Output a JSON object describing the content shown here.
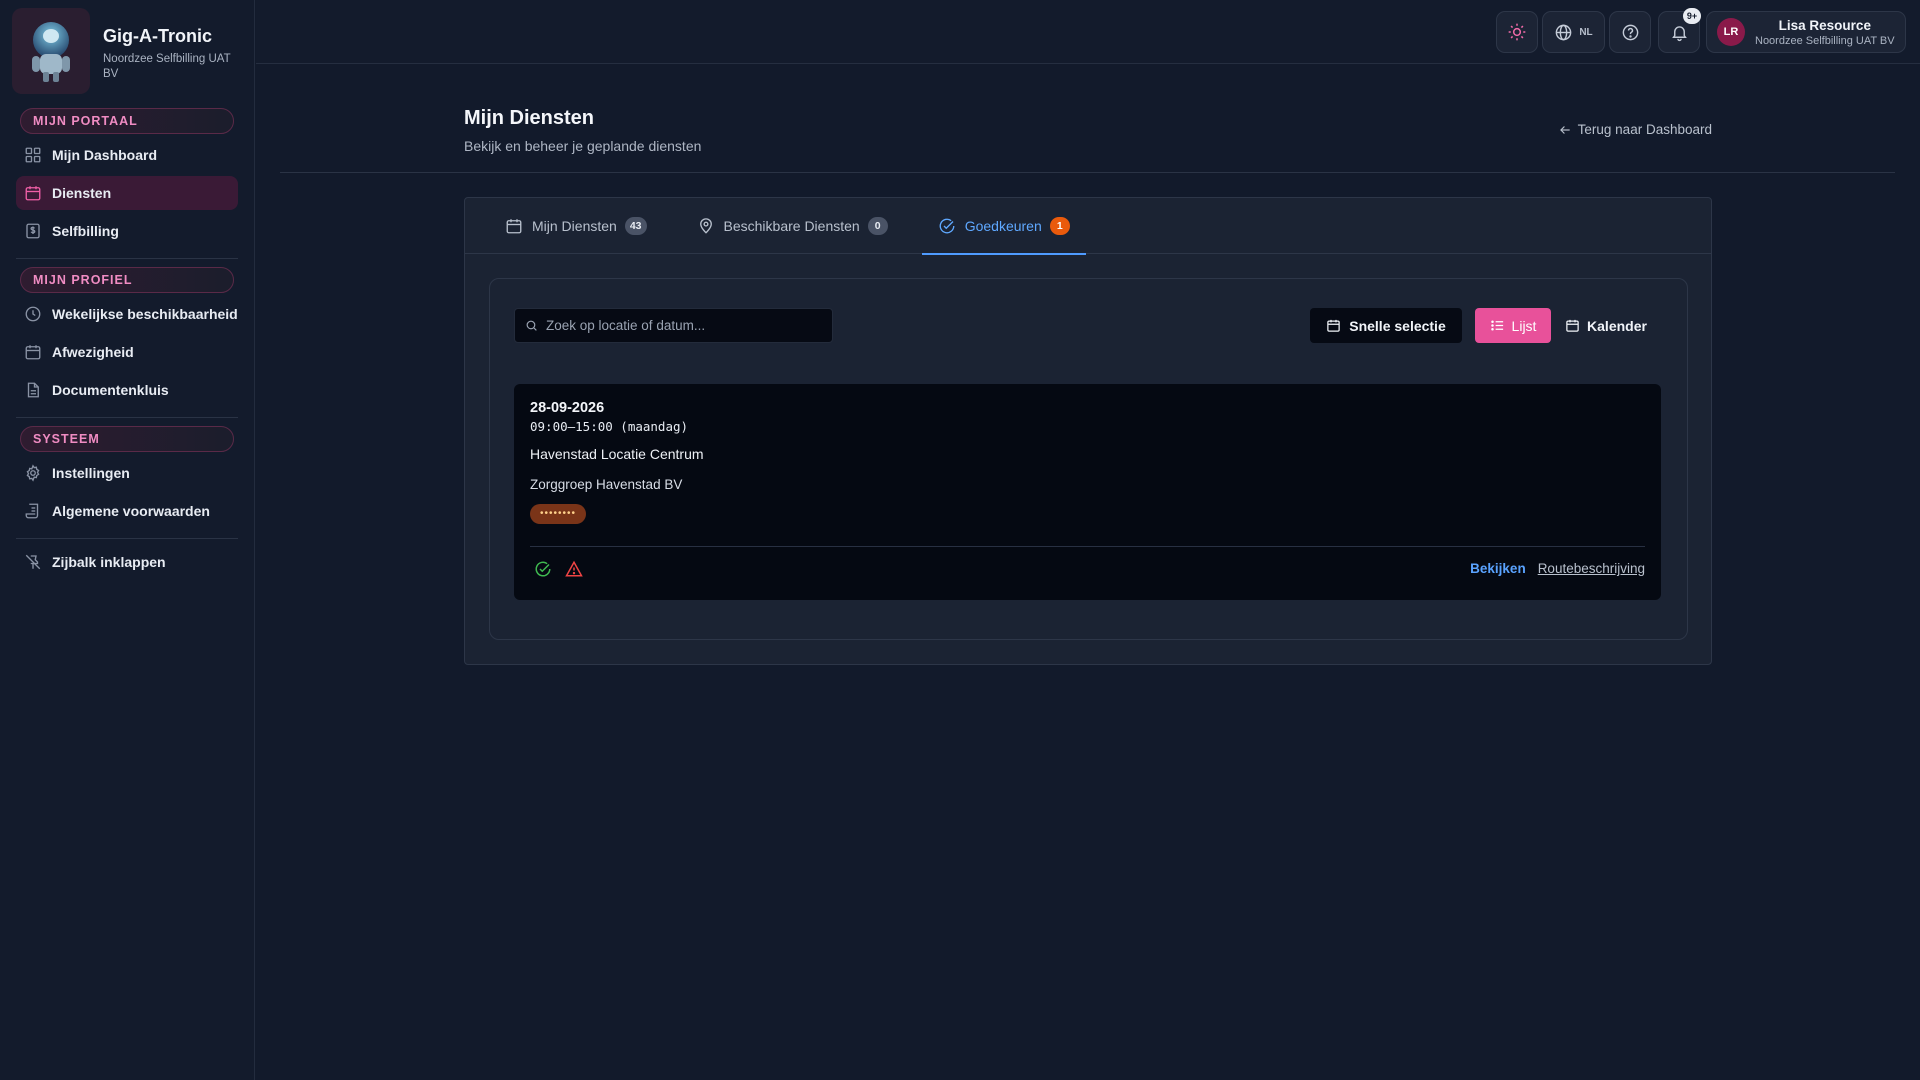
{
  "app": {
    "name": "Gig-A-Tronic",
    "org": "Noordzee Selfbilling UAT BV"
  },
  "sidebar": {
    "sections": [
      {
        "title": "MIJN PORTAAL",
        "items": [
          {
            "label": "Mijn Dashboard",
            "icon": "dashboard-icon",
            "active": false
          },
          {
            "label": "Diensten",
            "icon": "calendar-icon",
            "active": true
          },
          {
            "label": "Selfbilling",
            "icon": "invoice-icon",
            "active": false
          }
        ]
      },
      {
        "title": "MIJN PROFIEL",
        "items": [
          {
            "label": "Wekelijkse beschikbaarheid",
            "icon": "clock-icon",
            "active": false
          },
          {
            "label": "Afwezigheid",
            "icon": "calendar-icon",
            "active": false
          },
          {
            "label": "Documentenkluis",
            "icon": "document-icon",
            "active": false
          }
        ]
      },
      {
        "title": "SYSTEEM",
        "items": [
          {
            "label": "Instellingen",
            "icon": "gear-icon",
            "active": false
          },
          {
            "label": "Algemene voorwaarden",
            "icon": "terms-icon",
            "active": false
          }
        ]
      }
    ],
    "collapse_label": "Zijbalk inklappen"
  },
  "topbar": {
    "language": "NL",
    "notifications_badge": "9+",
    "user": {
      "initials": "LR",
      "name": "Lisa Resource",
      "org": "Noordzee Selfbilling UAT BV"
    }
  },
  "page": {
    "title": "Mijn Diensten",
    "subtitle": "Bekijk en beheer je geplande diensten",
    "back_label": "Terug naar Dashboard"
  },
  "tabs": [
    {
      "label": "Mijn Diensten",
      "count": "43",
      "active": false
    },
    {
      "label": "Beschikbare Diensten",
      "count": "0",
      "active": false
    },
    {
      "label": "Goedkeuren",
      "count": "1",
      "active": true
    }
  ],
  "toolbar": {
    "search_placeholder": "Zoek op locatie of datum...",
    "quick_select_label": "Snelle selectie",
    "list_label": "Lijst",
    "calendar_label": "Kalender"
  },
  "shifts": [
    {
      "date": "28-09-2026",
      "time": "09:00–15:00 (maandag)",
      "location": "Havenstad Locatie Centrum",
      "client": "Zorggroep Havenstad BV",
      "tag": "••••••••",
      "view_label": "Bekijken",
      "route_label": "Routebeschrijving"
    }
  ],
  "colors": {
    "accent_pink": "#e8519a",
    "accent_blue": "#4f9bff",
    "badge_orange": "#ea5a0c",
    "ok_green": "#3fb950",
    "warn_red": "#ef4444"
  }
}
